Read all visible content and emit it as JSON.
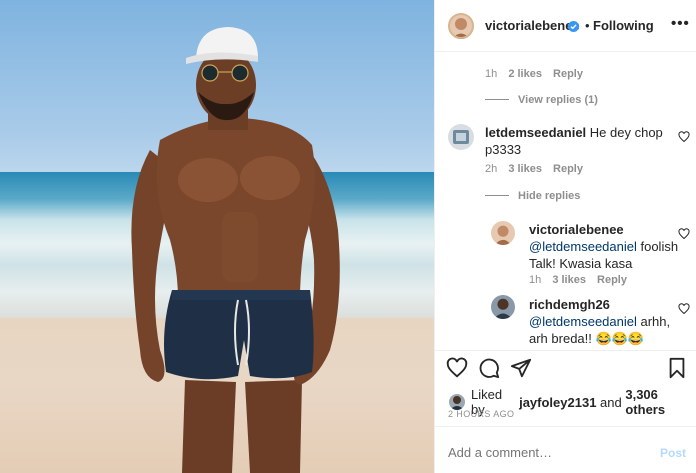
{
  "post": {
    "username": "victorialebenee",
    "separator": "•",
    "follow_status": "Following",
    "more": "•••"
  },
  "comments": [
    {
      "id": "reply-meta-1",
      "time": "1h",
      "likes": "2 likes",
      "reply": "Reply",
      "view_replies": "View replies (1)"
    },
    {
      "user": "letdemseedaniel",
      "text_line1": "He dey chop",
      "text_line2": "p3333",
      "time": "2h",
      "likes": "3 likes",
      "reply": "Reply",
      "hide_replies": "Hide replies",
      "replies": [
        {
          "user": "victorialebenee",
          "mention": "@letdemseedaniel",
          "text_line1_rest": " foolish",
          "text_line2": "Talk! Kwasia kasa",
          "time": "1h",
          "likes": "3 likes",
          "reply": "Reply"
        },
        {
          "user": "richdemgh26",
          "mention": "@letdemseedaniel",
          "text_line1_rest": " arhh,",
          "text_line2": "arh breda!! 😂😂😂"
        }
      ]
    }
  ],
  "likes_summary": {
    "prefix": "Liked by ",
    "user": "jayfoley2131",
    "middle": " and ",
    "others": "3,306 others"
  },
  "time_ago": "2 HOURS AGO",
  "add_comment": {
    "placeholder": "Add a comment…",
    "post_label": "Post"
  },
  "colors": {
    "link": "#00376b",
    "muted": "#8e8e8e",
    "verified": "#3897f0",
    "post_disabled": "#b3dbff"
  },
  "icons": [
    "heart-icon",
    "comment-icon",
    "share-icon",
    "bookmark-icon",
    "verified-icon",
    "more-icon"
  ]
}
